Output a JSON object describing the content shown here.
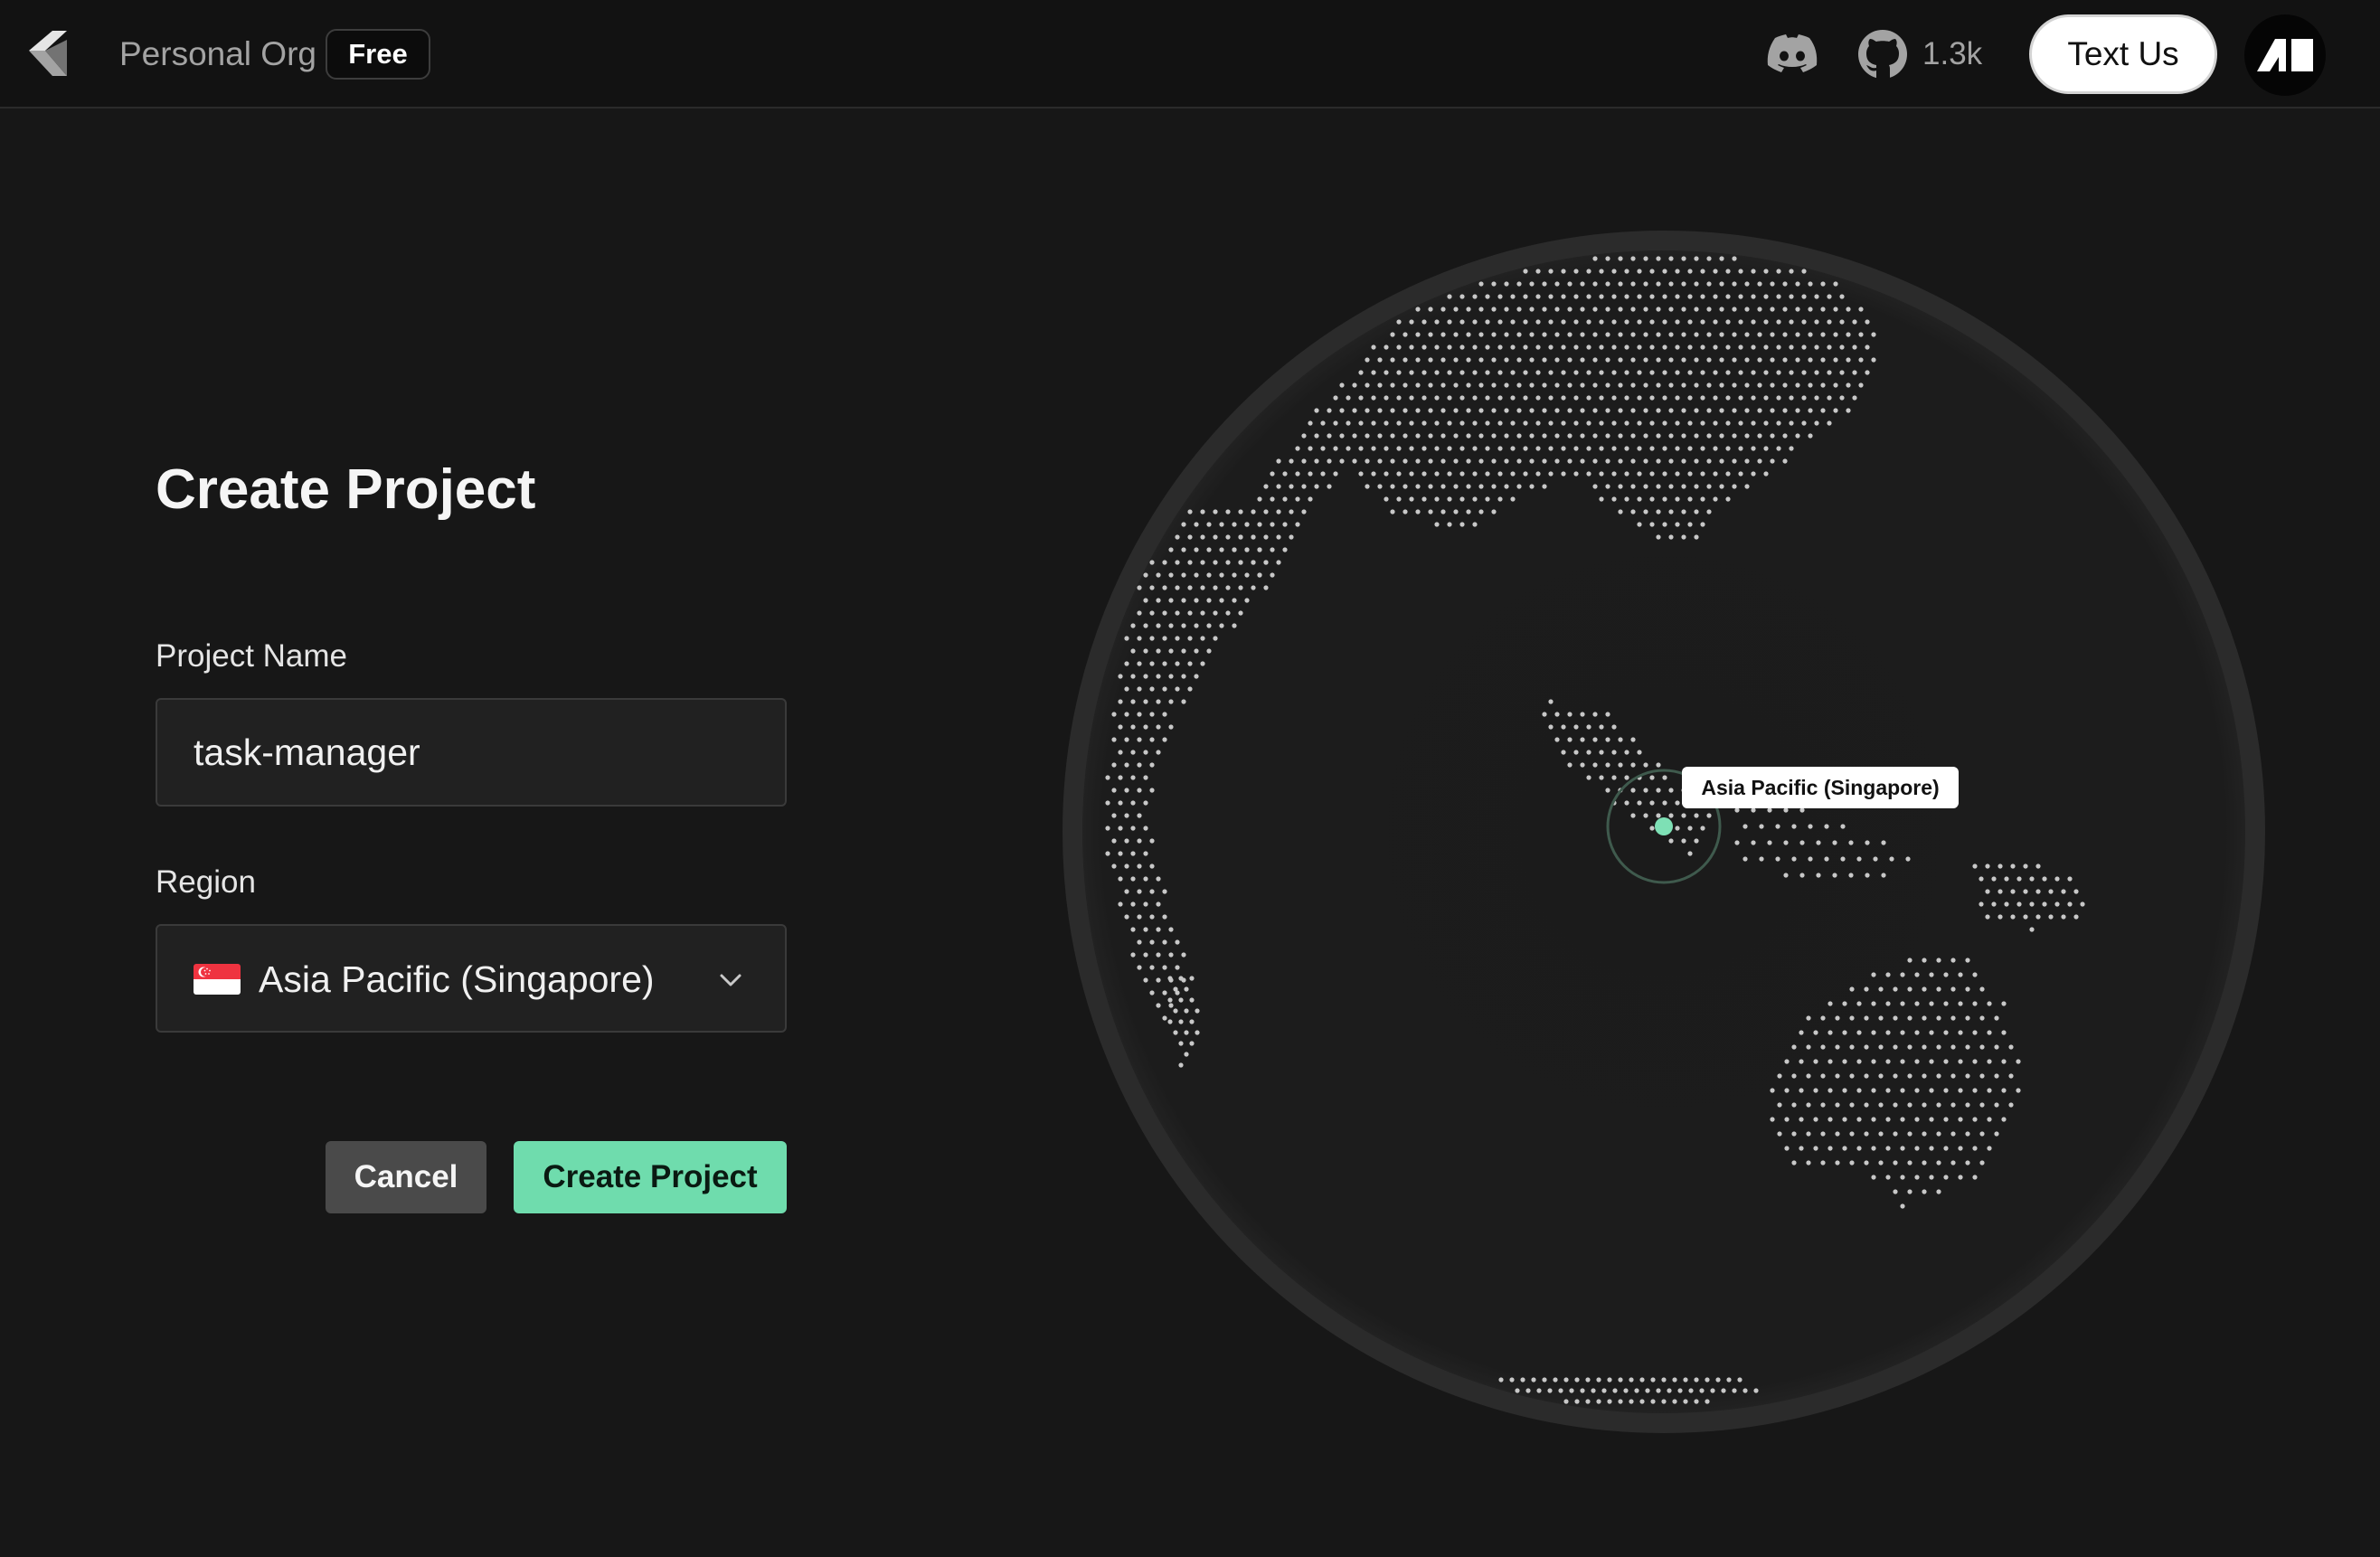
{
  "header": {
    "org_name": "Personal Org",
    "plan_badge": "Free",
    "github_stars": "1.3k",
    "text_us_label": "Text Us",
    "icons": {
      "logo": "app-logo-icon",
      "discord": "discord-icon",
      "github": "github-icon",
      "avatar": "avatar-logo-icon"
    }
  },
  "form": {
    "title": "Create Project",
    "project_name": {
      "label": "Project Name",
      "value": "task-manager"
    },
    "region": {
      "label": "Region",
      "value": "Asia Pacific (Singapore)",
      "flag": "singapore-flag-icon"
    },
    "cancel_label": "Cancel",
    "submit_label": "Create Project"
  },
  "globe": {
    "selected_region_label": "Asia Pacific (Singapore)"
  },
  "colors": {
    "background": "#171717",
    "topbar": "#121212",
    "accent": "#6fdcad",
    "marker": "#7ee0b5"
  }
}
